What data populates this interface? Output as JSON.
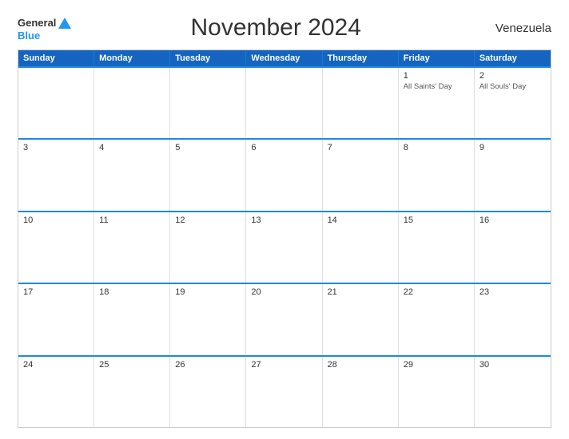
{
  "header": {
    "logo_general": "General",
    "logo_blue": "Blue",
    "title": "November 2024",
    "country": "Venezuela"
  },
  "day_headers": [
    "Sunday",
    "Monday",
    "Tuesday",
    "Wednesday",
    "Thursday",
    "Friday",
    "Saturday"
  ],
  "weeks": [
    {
      "cells": [
        {
          "date": "",
          "events": [],
          "empty": true
        },
        {
          "date": "",
          "events": [],
          "empty": true
        },
        {
          "date": "",
          "events": [],
          "empty": true
        },
        {
          "date": "",
          "events": [],
          "empty": true
        },
        {
          "date": "",
          "events": [],
          "empty": true
        },
        {
          "date": "1",
          "events": [
            "All Saints' Day"
          ],
          "empty": false
        },
        {
          "date": "2",
          "events": [
            "All Souls' Day"
          ],
          "empty": false
        }
      ]
    },
    {
      "cells": [
        {
          "date": "3",
          "events": [],
          "empty": false
        },
        {
          "date": "4",
          "events": [],
          "empty": false
        },
        {
          "date": "5",
          "events": [],
          "empty": false
        },
        {
          "date": "6",
          "events": [],
          "empty": false
        },
        {
          "date": "7",
          "events": [],
          "empty": false
        },
        {
          "date": "8",
          "events": [],
          "empty": false
        },
        {
          "date": "9",
          "events": [],
          "empty": false
        }
      ]
    },
    {
      "cells": [
        {
          "date": "10",
          "events": [],
          "empty": false
        },
        {
          "date": "11",
          "events": [],
          "empty": false
        },
        {
          "date": "12",
          "events": [],
          "empty": false
        },
        {
          "date": "13",
          "events": [],
          "empty": false
        },
        {
          "date": "14",
          "events": [],
          "empty": false
        },
        {
          "date": "15",
          "events": [],
          "empty": false
        },
        {
          "date": "16",
          "events": [],
          "empty": false
        }
      ]
    },
    {
      "cells": [
        {
          "date": "17",
          "events": [],
          "empty": false
        },
        {
          "date": "18",
          "events": [],
          "empty": false
        },
        {
          "date": "19",
          "events": [],
          "empty": false
        },
        {
          "date": "20",
          "events": [],
          "empty": false
        },
        {
          "date": "21",
          "events": [],
          "empty": false
        },
        {
          "date": "22",
          "events": [],
          "empty": false
        },
        {
          "date": "23",
          "events": [],
          "empty": false
        }
      ]
    },
    {
      "cells": [
        {
          "date": "24",
          "events": [],
          "empty": false
        },
        {
          "date": "25",
          "events": [],
          "empty": false
        },
        {
          "date": "26",
          "events": [],
          "empty": false
        },
        {
          "date": "27",
          "events": [],
          "empty": false
        },
        {
          "date": "28",
          "events": [],
          "empty": false
        },
        {
          "date": "29",
          "events": [],
          "empty": false
        },
        {
          "date": "30",
          "events": [],
          "empty": false
        }
      ]
    }
  ]
}
